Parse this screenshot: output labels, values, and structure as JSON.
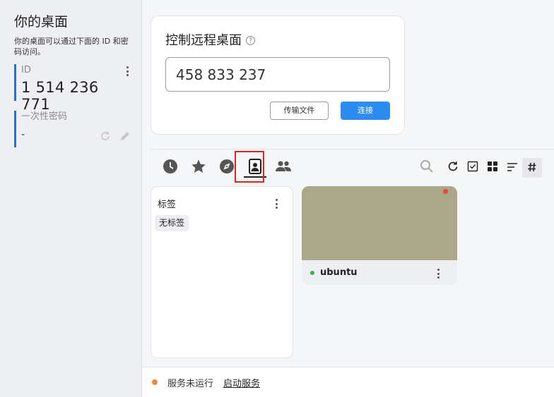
{
  "sidebar": {
    "title": "你的桌面",
    "description": "你的桌面可以通过下面的 ID 和密码访问。",
    "id_label": "ID",
    "id_value": "1 514 236 771",
    "password_label": "一次性密码",
    "password_value": "-"
  },
  "remote": {
    "title": "控制远程桌面",
    "help_icon": "?",
    "input_value": "458 833 237",
    "transfer_label": "传输文件",
    "connect_label": "连接"
  },
  "tabs": [
    {
      "icon": "history-icon"
    },
    {
      "icon": "star-icon"
    },
    {
      "icon": "compass-icon"
    },
    {
      "icon": "address-book-icon",
      "active": true
    },
    {
      "icon": "group-icon"
    }
  ],
  "tools": [
    {
      "icon": "search-icon"
    },
    {
      "icon": "refresh-icon"
    },
    {
      "icon": "checkbox-icon"
    },
    {
      "icon": "grid-view-icon"
    },
    {
      "icon": "sort-icon"
    },
    {
      "icon": "hash-icon",
      "active": true
    }
  ],
  "tags_panel": {
    "title": "标签",
    "chip": "无标签"
  },
  "peers": [
    {
      "name": "ubuntu",
      "online": true,
      "thumb_color": "#aaa78a"
    }
  ],
  "status": {
    "text": "服务未运行",
    "link": "启动服务"
  },
  "colors": {
    "accent": "#2d8cf0",
    "id_bar": "#2a6fcc",
    "highlight": "#e02424",
    "status_dot": "#ec8a3c",
    "online": "#3cb043"
  }
}
